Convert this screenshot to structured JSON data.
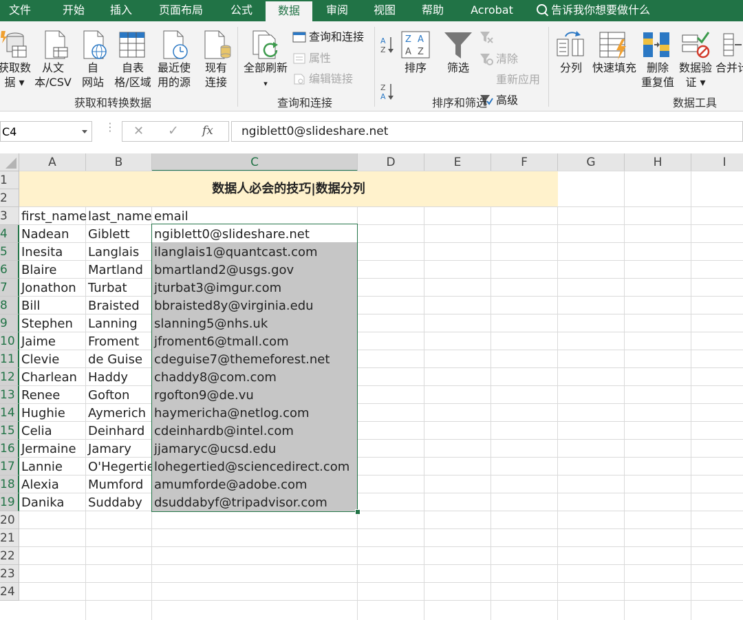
{
  "ribbon_tabs": [
    "文件",
    "开始",
    "插入",
    "页面布局",
    "公式",
    "数据",
    "审阅",
    "视图",
    "帮助",
    "Acrobat"
  ],
  "active_tab": "数据",
  "tell_me": "告诉我你想要做什么",
  "groups": {
    "get_transform": {
      "label": "获取和转换数据",
      "buttons": [
        {
          "line1": "获取数",
          "line2": "据 ▾"
        },
        {
          "line1": "从文",
          "line2": "本/CSV"
        },
        {
          "line1": "自",
          "line2": "网站"
        },
        {
          "line1": "自表",
          "line2": "格/区域"
        },
        {
          "line1": "最近使",
          "line2": "用的源"
        },
        {
          "line1": "现有",
          "line2": "连接"
        }
      ]
    },
    "queries": {
      "label": "查询和连接",
      "refresh_line1": "全部刷新",
      "refresh_line2": "▾",
      "items": [
        "查询和连接",
        "属性",
        "编辑链接"
      ]
    },
    "sort_filter": {
      "label": "排序和筛选",
      "sort": "排序",
      "filter": "筛选",
      "items": [
        "清除",
        "重新应用",
        "高级"
      ]
    },
    "data_tools": {
      "label": "数据工具",
      "buttons": [
        {
          "line1": "分列",
          "line2": ""
        },
        {
          "line1": "快速填充",
          "line2": ""
        },
        {
          "line1": "删除",
          "line2": "重复值"
        },
        {
          "line1": "数据验",
          "line2": "证 ▾"
        },
        {
          "line1": "合并计",
          "line2": ""
        }
      ]
    }
  },
  "formula_bar": {
    "name_box": "C4",
    "formula": "ngiblett0@slideshare.net",
    "cancel_glyph": "✕",
    "enter_glyph": "✓",
    "fx_glyph": "fx"
  },
  "columns": [
    "A",
    "B",
    "C",
    "D",
    "E",
    "F",
    "G",
    "H",
    "I"
  ],
  "row_numbers": [
    "1",
    "2",
    "3",
    "4",
    "5",
    "6",
    "7",
    "8",
    "9",
    "10",
    "11",
    "12",
    "13",
    "14",
    "15",
    "16",
    "17",
    "18",
    "19",
    "20",
    "21",
    "22",
    "23",
    "24"
  ],
  "sheet_title": "数据人必会的技巧|数据分列",
  "headers": [
    "first_name",
    "last_name",
    "email"
  ],
  "rows": [
    [
      "Nadean",
      "Giblett",
      "ngiblett0@slideshare.net"
    ],
    [
      "Inesita",
      "Langlais",
      "ilanglais1@quantcast.com"
    ],
    [
      "Blaire",
      "Martland",
      "bmartland2@usgs.gov"
    ],
    [
      "Jonathon",
      "Turbat",
      "jturbat3@imgur.com"
    ],
    [
      "Bill",
      "Braisted",
      "bbraisted8y@virginia.edu"
    ],
    [
      "Stephen",
      "Lanning",
      "slanning5@nhs.uk"
    ],
    [
      "Jaime",
      "Froment",
      "jfroment6@tmall.com"
    ],
    [
      "Clevie",
      "de Guise",
      "cdeguise7@themeforest.net"
    ],
    [
      "Charlean",
      "Haddy",
      "chaddy8@com.com"
    ],
    [
      "Renee",
      "Gofton",
      "rgofton9@de.vu"
    ],
    [
      "Hughie",
      "Aymerich",
      "haymericha@netlog.com"
    ],
    [
      "Celia",
      "Deinhard",
      "cdeinhardb@intel.com"
    ],
    [
      "Jermaine",
      "Jamary",
      "jjamaryc@ucsd.edu"
    ],
    [
      "Lannie",
      "O'Hegertie",
      "lohegertied@sciencedirect.com"
    ],
    [
      "Alexia",
      "Mumford",
      "amumforde@adobe.com"
    ],
    [
      "Danika",
      "Suddaby",
      "dsuddabyf@tripadvisor.com"
    ]
  ],
  "colors": {
    "excel_green": "#217346",
    "title_fill": "#fff2cc",
    "selection_fill": "#c6c6c6"
  }
}
